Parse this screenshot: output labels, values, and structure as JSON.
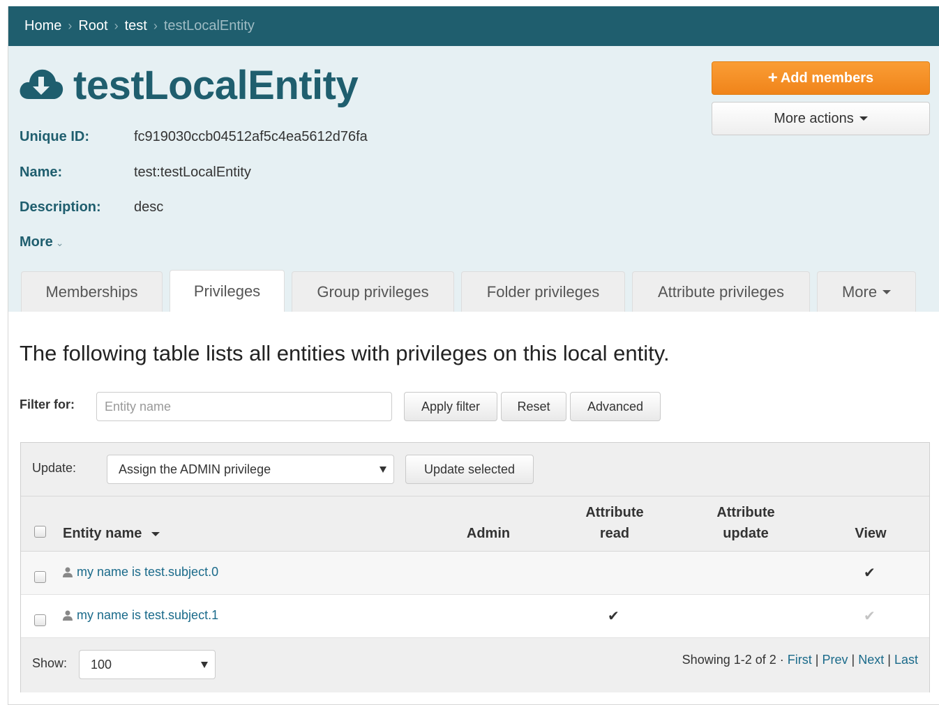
{
  "breadcrumb": {
    "items": [
      "Home",
      "Root",
      "test"
    ],
    "current": "testLocalEntity",
    "separator": "›"
  },
  "entity": {
    "title": "testLocalEntity",
    "icon": "cloud-download-icon",
    "fields": [
      {
        "label": "Unique ID:",
        "value": "fc919030ccb04512af5c4ea5612d76fa"
      },
      {
        "label": "Name:",
        "value": "test:testLocalEntity"
      },
      {
        "label": "Description:",
        "value": "desc"
      }
    ],
    "more_label": "More"
  },
  "actions": {
    "add_members": "Add members",
    "more_actions": "More actions"
  },
  "tabs": [
    {
      "label": "Memberships",
      "active": false
    },
    {
      "label": "Privileges",
      "active": true
    },
    {
      "label": "Group privileges",
      "active": false
    },
    {
      "label": "Folder privileges",
      "active": false
    },
    {
      "label": "Attribute privileges",
      "active": false
    },
    {
      "label": "More",
      "active": false
    }
  ],
  "main": {
    "intro": "The following table lists all entities with privileges on this local entity."
  },
  "filter": {
    "label": "Filter for:",
    "placeholder": "Entity name",
    "value": "",
    "apply": "Apply filter",
    "reset": "Reset",
    "advanced": "Advanced"
  },
  "update": {
    "label": "Update:",
    "selected": "Assign the ADMIN privilege",
    "button": "Update selected"
  },
  "table": {
    "columns": {
      "entity": "Entity name",
      "admin": "Admin",
      "attr_read_1": "Attribute",
      "attr_read_2": "read",
      "attr_update_1": "Attribute",
      "attr_update_2": "update",
      "view": "View"
    },
    "rows": [
      {
        "name": "my name is test.subject.0",
        "admin": false,
        "attribute_read": false,
        "attribute_update": false,
        "view": true,
        "view_inherited": false
      },
      {
        "name": "my name is test.subject.1",
        "admin": false,
        "attribute_read": true,
        "attribute_update": false,
        "view": true,
        "view_inherited": true
      }
    ]
  },
  "footer": {
    "show_label": "Show:",
    "page_size": "100",
    "showing": "Showing 1-2 of 2 ·",
    "first": "First",
    "prev": "Prev",
    "next": "Next",
    "last": "Last",
    "sep": "|"
  },
  "colors": {
    "brand": "#1f5e6e",
    "accent": "#f78f1e",
    "link": "#1a6a8a"
  }
}
